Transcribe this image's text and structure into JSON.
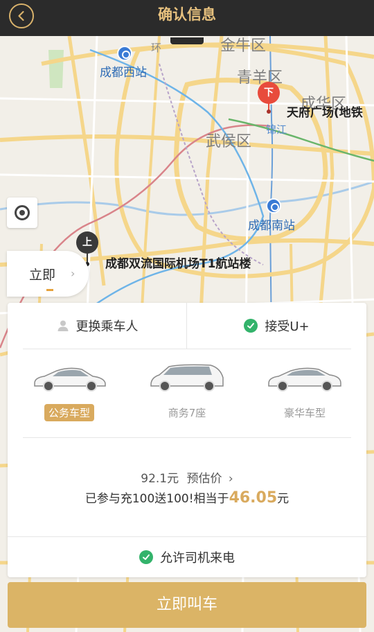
{
  "header": {
    "title": "确认信息"
  },
  "map": {
    "districts": [
      "金牛区",
      "青羊区",
      "成华区",
      "武侯区"
    ],
    "stations": [
      "成都西站",
      "成都南站"
    ],
    "small_labels": [
      "锦江",
      "环"
    ],
    "dropoff": {
      "marker": "下",
      "name": "天府广场(地铁"
    },
    "pickup": {
      "marker": "上",
      "name": "成都双流国际机场T1航站楼"
    }
  },
  "time": {
    "label": "立即"
  },
  "options": {
    "change_passenger": "更换乘车人",
    "accept_u": "接受U+"
  },
  "cars": [
    {
      "label": "公务车型",
      "selected": true
    },
    {
      "label": "商务7座",
      "selected": false
    },
    {
      "label": "豪华车型",
      "selected": false
    }
  ],
  "price": {
    "amount": "92.1元",
    "estimate_label": "预估价",
    "promo_prefix": "已参与充100送100!相当于",
    "promo_amount": "46.05",
    "promo_suffix": "元"
  },
  "allow_call": "允许司机来电",
  "call_button": "立即叫车",
  "colors": {
    "header_bg": "#2b2b2b",
    "accent_gold": "#d9aa5e",
    "check_green": "#33b36b",
    "pin_red": "#e84b3c"
  }
}
